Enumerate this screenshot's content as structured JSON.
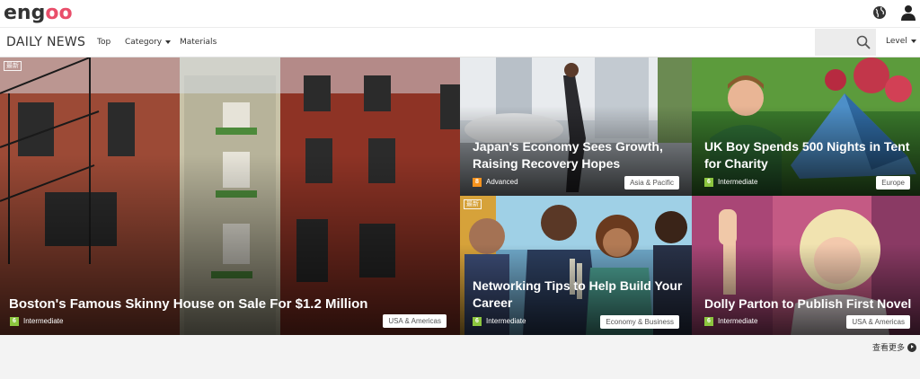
{
  "header": {
    "logo": {
      "e": "en",
      "g1": "g",
      "o": "oo"
    },
    "globe_icon": "globe-icon",
    "user_icon": "user-icon"
  },
  "nav": {
    "brand": "DAILY NEWS",
    "items": [
      {
        "label": "Top"
      },
      {
        "label": "Category"
      },
      {
        "label": "Materials"
      }
    ],
    "level": "Level"
  },
  "articles": [
    {
      "title": "Boston's Famous Skinny House on Sale For $1.2 Million",
      "level_num": "6",
      "level_label": "Intermediate",
      "region": "USA & Americas",
      "level_color": "#8cc63f",
      "tag": "最新"
    },
    {
      "title": "Japan's Economy Sees Growth, Raising Recovery Hopes",
      "level_num": "8",
      "level_label": "Advanced",
      "region": "Asia & Pacific",
      "level_color": "#f7931e",
      "tag": ""
    },
    {
      "title": "UK Boy Spends 500 Nights in Tent for Charity",
      "level_num": "6",
      "level_label": "Intermediate",
      "region": "Europe",
      "level_color": "#8cc63f",
      "tag": ""
    },
    {
      "title": "Networking Tips to Help Build Your Career",
      "level_num": "6",
      "level_label": "Intermediate",
      "region": "Economy & Business",
      "level_color": "#8cc63f",
      "tag": "最新"
    },
    {
      "title": "Dolly Parton to Publish First Novel",
      "level_num": "6",
      "level_label": "Intermediate",
      "region": "USA & Americas",
      "level_color": "#8cc63f",
      "tag": ""
    }
  ],
  "footer": {
    "more": "查看更多"
  }
}
